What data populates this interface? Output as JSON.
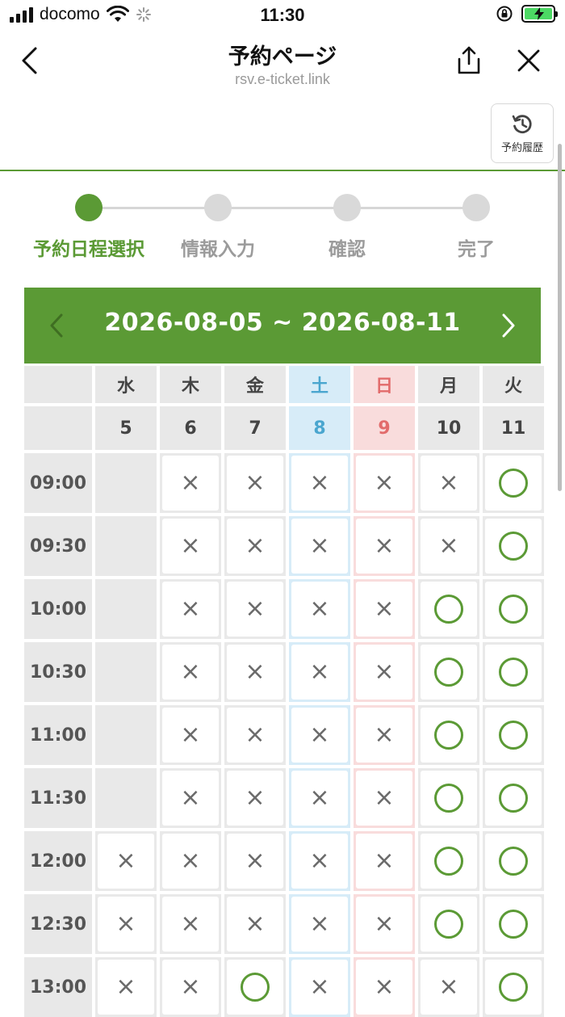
{
  "status_bar": {
    "carrier": "docomo",
    "time": "11:30"
  },
  "header": {
    "title": "予約ページ",
    "url": "rsv.e-ticket.link",
    "history_label": "予約履歴"
  },
  "steps": [
    {
      "label": "予約日程選択",
      "active": true
    },
    {
      "label": "情報入力",
      "active": false
    },
    {
      "label": "確認",
      "active": false
    },
    {
      "label": "完了",
      "active": false
    }
  ],
  "calendar": {
    "range": "2026-08-05 ~ 2026-08-11",
    "weekdays": [
      "水",
      "木",
      "金",
      "土",
      "日",
      "月",
      "火"
    ],
    "dates": [
      "5",
      "6",
      "7",
      "8",
      "9",
      "10",
      "11"
    ],
    "rows": [
      {
        "time": "09:00",
        "slots": [
          "",
          "×",
          "×",
          "×",
          "×",
          "×",
          "○"
        ]
      },
      {
        "time": "09:30",
        "slots": [
          "",
          "×",
          "×",
          "×",
          "×",
          "×",
          "○"
        ]
      },
      {
        "time": "10:00",
        "slots": [
          "",
          "×",
          "×",
          "×",
          "×",
          "○",
          "○"
        ]
      },
      {
        "time": "10:30",
        "slots": [
          "",
          "×",
          "×",
          "×",
          "×",
          "○",
          "○"
        ]
      },
      {
        "time": "11:00",
        "slots": [
          "",
          "×",
          "×",
          "×",
          "×",
          "○",
          "○"
        ]
      },
      {
        "time": "11:30",
        "slots": [
          "",
          "×",
          "×",
          "×",
          "×",
          "○",
          "○"
        ]
      },
      {
        "time": "12:00",
        "slots": [
          "×",
          "×",
          "×",
          "×",
          "×",
          "○",
          "○"
        ]
      },
      {
        "time": "12:30",
        "slots": [
          "×",
          "×",
          "×",
          "×",
          "×",
          "○",
          "○"
        ]
      },
      {
        "time": "13:00",
        "slots": [
          "×",
          "×",
          "○",
          "×",
          "×",
          "×",
          "○"
        ]
      }
    ]
  },
  "colors": {
    "accent": "#5b9a35",
    "saturday": "#4aa6cf",
    "sunday": "#e26b6b"
  }
}
